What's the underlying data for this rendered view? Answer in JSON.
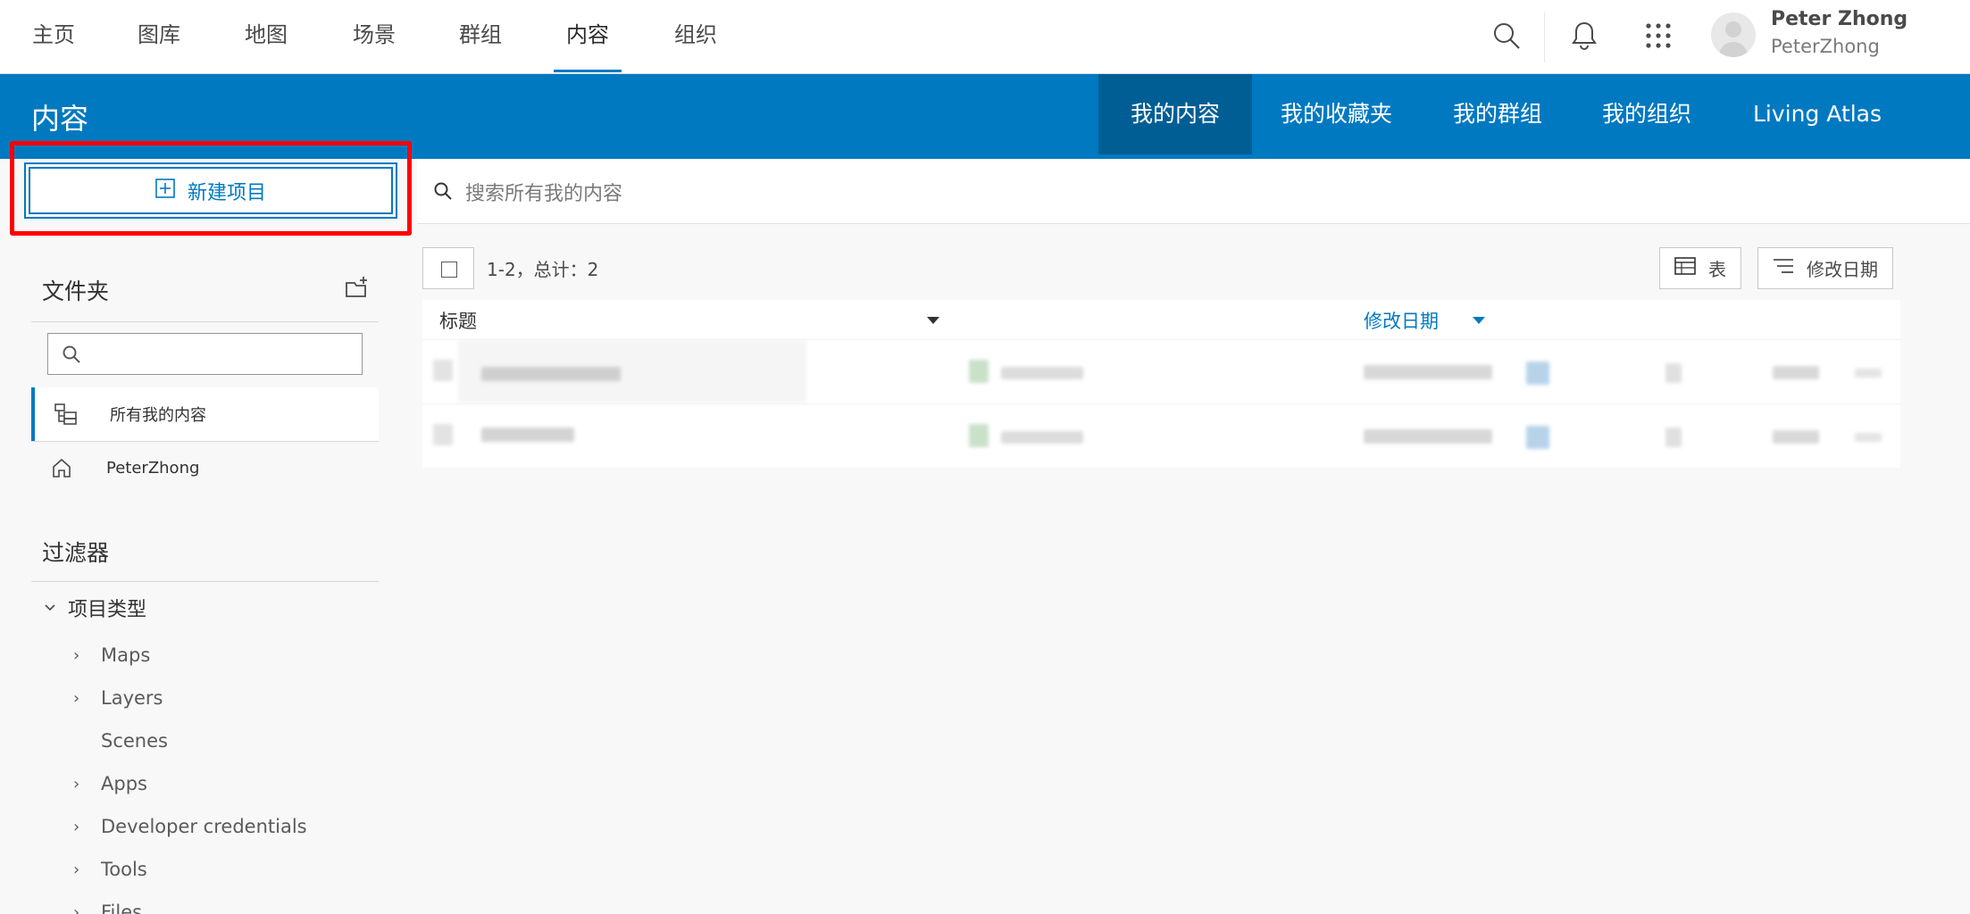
{
  "topnav": {
    "items": [
      {
        "label": "主页"
      },
      {
        "label": "图库"
      },
      {
        "label": "地图"
      },
      {
        "label": "场景"
      },
      {
        "label": "群组"
      },
      {
        "label": "内容"
      },
      {
        "label": "组织"
      }
    ],
    "active_label": "内容",
    "icons": [
      "search-icon",
      "bell-icon",
      "apps-grid-icon"
    ],
    "user": {
      "name": "Peter Zhong",
      "username": "PeterZhong"
    }
  },
  "header": {
    "title": "内容",
    "tabs": [
      {
        "label": "我的内容"
      },
      {
        "label": "我的收藏夹"
      },
      {
        "label": "我的群组"
      },
      {
        "label": "我的组织"
      },
      {
        "label": "Living Atlas"
      }
    ],
    "active_tab": "我的内容"
  },
  "sidebar": {
    "new_item_label": "新建项目",
    "folders_title": "文件夹",
    "folder_search_placeholder": "",
    "folders": [
      {
        "label": "所有我的内容"
      },
      {
        "label": "PeterZhong"
      }
    ],
    "filters_title": "过滤器",
    "filter_group": "项目类型",
    "filter_items": [
      {
        "label": "Maps"
      },
      {
        "label": "Layers"
      },
      {
        "label": "Scenes"
      },
      {
        "label": "Apps"
      },
      {
        "label": "Developer credentials"
      },
      {
        "label": "Tools"
      },
      {
        "label": "Files"
      }
    ]
  },
  "main": {
    "search_placeholder": "搜索所有我的内容",
    "count_text": "1-2，总计：2",
    "table_view_label": "表",
    "sort_label": "修改日期",
    "columns": {
      "title": "标题",
      "modified": "修改日期"
    }
  },
  "colors": {
    "accent": "#0079c1",
    "accent_dark": "#005e95",
    "highlight": "#ff0000"
  }
}
